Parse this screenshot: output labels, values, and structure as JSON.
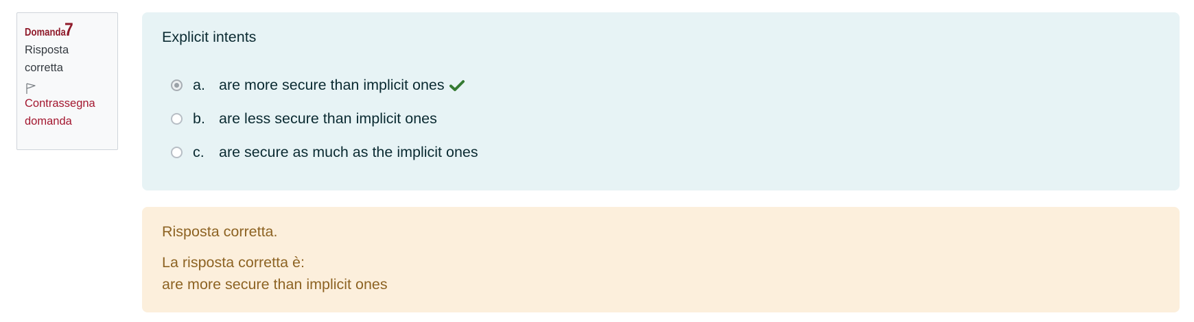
{
  "question_info": {
    "label": "Domanda",
    "number": "7",
    "state": "Risposta corretta",
    "flag_label": "Contrassegna domanda",
    "accent_color": "#8f1a2a"
  },
  "question": {
    "text": "Explicit intents",
    "selected": "a",
    "answers": [
      {
        "letter": "a.",
        "text": "are more secure than implicit ones",
        "selected": true,
        "correct_mark": "check-icon"
      },
      {
        "letter": "b.",
        "text": "are less secure than implicit ones",
        "selected": false
      },
      {
        "letter": "c.",
        "text": "are secure as much as the implicit ones",
        "selected": false
      }
    ],
    "correct_color": "#357a32"
  },
  "feedback": {
    "result": "Risposta corretta.",
    "right_answer_label": "La risposta corretta è:",
    "right_answer": "are more secure than implicit ones"
  }
}
